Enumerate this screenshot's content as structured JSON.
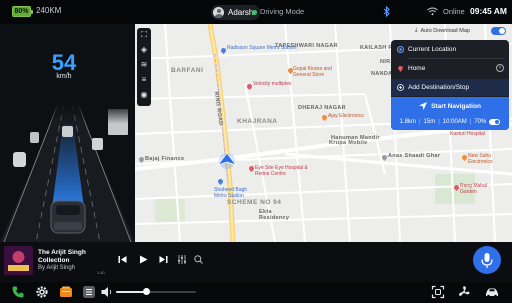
{
  "status_bar": {
    "battery_percent": "80%",
    "range": "240KM",
    "profile_name": "Adarsh",
    "drive_mode": "Driving Mode",
    "connection": "Online",
    "time": "09:45 AM"
  },
  "cluster": {
    "speed": "54",
    "unit": "km/h"
  },
  "map": {
    "auto_download_label": "Auto Download Map",
    "auto_download_on": true,
    "area_labels": [
      "BARFANI",
      "KHAJRANA",
      "SCHEME NO 94",
      "NANDA NAGAR",
      "NIRANJANPUR"
    ],
    "place_labels": [
      "Radisson Square Metro Station",
      "Gopal Kirana and General Store",
      "Velocity multiplex",
      "Ajay Electronics",
      "Eye Site Eye Hospital & Retina Centre",
      "Shaheed Bagh Metro Station",
      "Kasturi Hospital",
      "Anas Shaadi Ghar",
      "New Sahu Electronics",
      "Rang Mahal Garden",
      "Bajaj Finance",
      "Krupa Mobile",
      "Hanuman Mandir",
      "Ekta Residency"
    ],
    "road_labels": [
      "RING ROAD",
      "RING ROAD"
    ]
  },
  "navigation": {
    "current_location_label": "Current Location",
    "destination": "Home",
    "add_stop_label": "Add Destination/Stop",
    "start_label": "Start Navigation",
    "distance": "1.8km",
    "duration": "15m",
    "eta": "10:00AM",
    "battery_at_arrival": "70%"
  },
  "media": {
    "title": "The Arijit Singh Collection",
    "artist": "By Arijit Singh",
    "elapsed": "1:40",
    "volume_level": 0.38
  },
  "dock": {
    "icons": [
      "phone-icon",
      "settings-icon",
      "media-app-icon",
      "menu-icon",
      "volume-icon",
      "screen-capture-icon",
      "fan-icon",
      "car-icon"
    ]
  },
  "colors": {
    "accent": "#2f6fe8",
    "speed": "#3aa0ff",
    "battery": "#5fae38",
    "drive_mode_dot": "#36c66a"
  }
}
